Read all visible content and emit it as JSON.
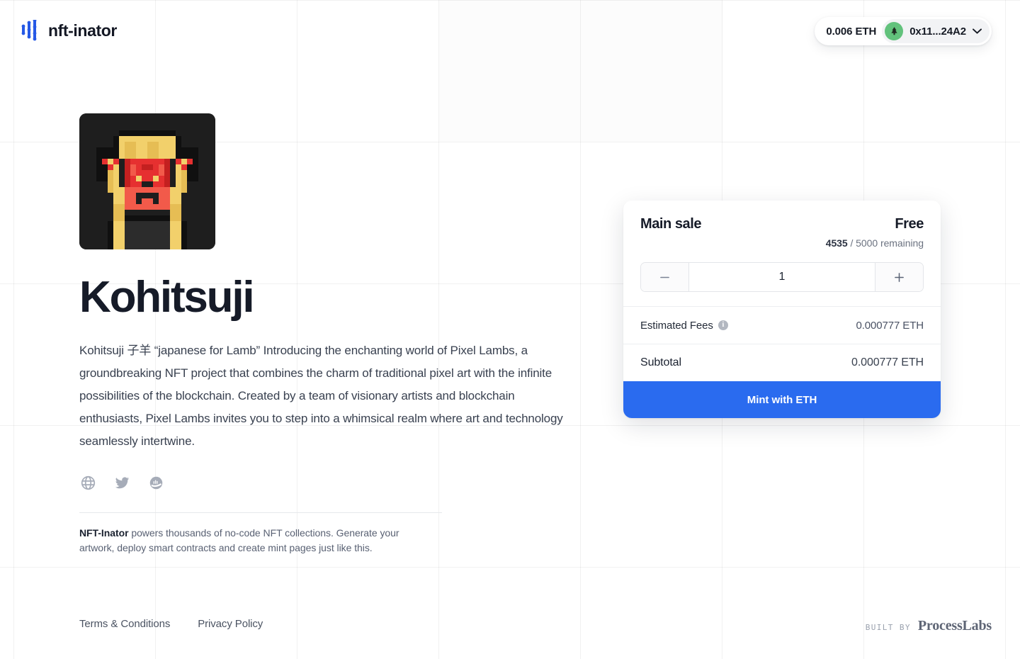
{
  "header": {
    "brand_name": "nft-inator",
    "brand_icon": "nft-inator-logo-icon",
    "wallet": {
      "balance": "0.006 ETH",
      "address": "0x11...24A2",
      "avatar_icon": "wallet-avatar-tree-icon",
      "chevron_icon": "chevron-down-icon",
      "avatar_color": "#62c27c"
    }
  },
  "collection": {
    "artwork_alt": "pixel-art-lamb-avatar",
    "title": "Kohitsuji",
    "description": "Kohitsuji 子羊 “japanese for Lamb”  Introducing the enchanting world of Pixel Lambs, a groundbreaking NFT project that combines the charm of traditional pixel art with the infinite possibilities of the blockchain. Created by a team of visionary artists and blockchain enthusiasts, Pixel Lambs invites you to step into a whimsical realm where art and technology seamlessly intertwine.",
    "socials": [
      {
        "name": "website",
        "icon": "globe-icon"
      },
      {
        "name": "twitter",
        "icon": "twitter-bird-icon"
      },
      {
        "name": "opensea",
        "icon": "opensea-icon"
      }
    ],
    "promo_bold": "NFT-Inator",
    "promo_rest": " powers thousands of no-code NFT collections. Generate your artwork, deploy smart contracts and create mint pages just like this."
  },
  "mint": {
    "sale_name": "Main sale",
    "price": "Free",
    "remaining_count": "4535",
    "remaining_suffix": " / 5000 remaining",
    "quantity": "1",
    "decrement_icon": "minus-icon",
    "increment_icon": "plus-icon",
    "fees_label": "Estimated Fees",
    "fees_info_icon": "info-icon",
    "fees_value": "0.000777 ETH",
    "subtotal_label": "Subtotal",
    "subtotal_value": "0.000777 ETH",
    "mint_button_label": "Mint with ETH",
    "accent_color": "#2a6bef"
  },
  "footer": {
    "terms_label": "Terms & Conditions",
    "privacy_label": "Privacy Policy",
    "built_by_label": "BUILT BY",
    "built_by_name": "ProcessLabs"
  }
}
